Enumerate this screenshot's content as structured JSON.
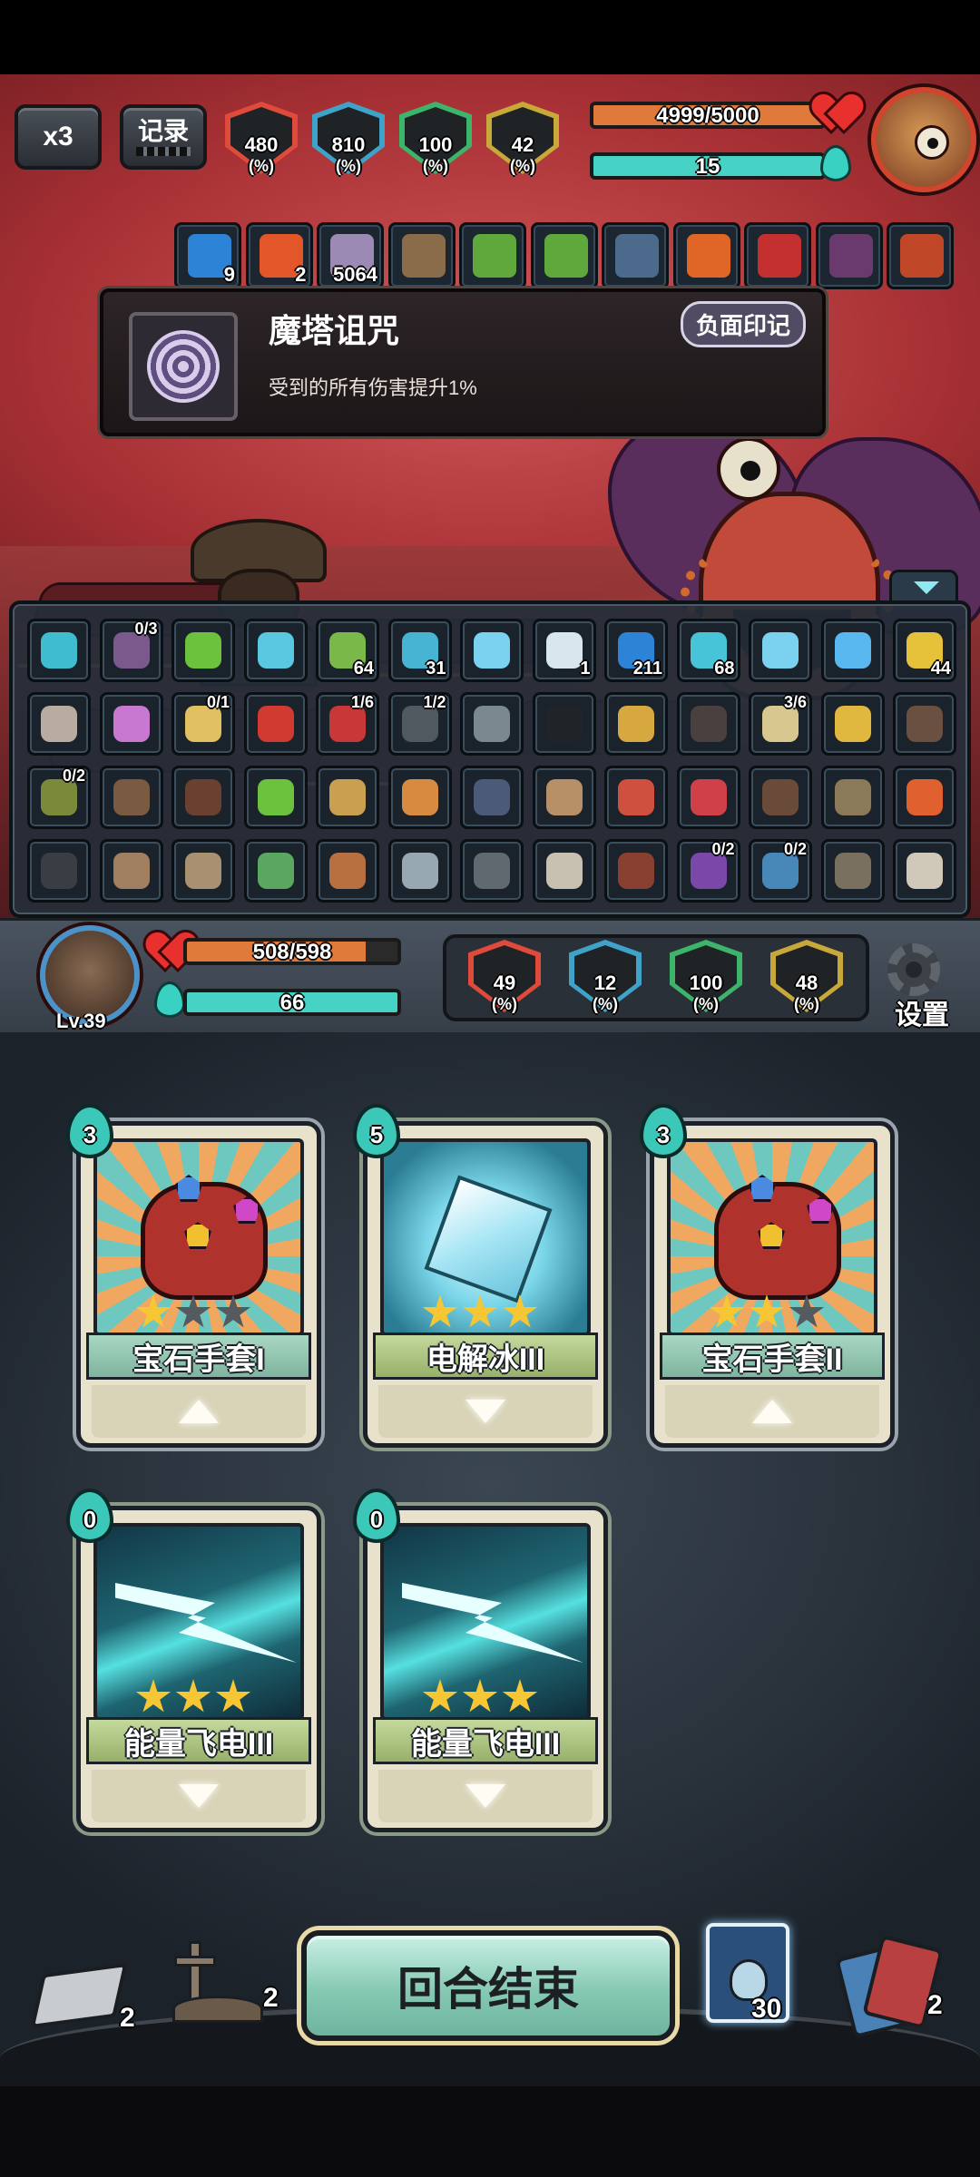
{
  "top_hud": {
    "speed_label": "x3",
    "record_label": "记录",
    "enemy_stats": [
      {
        "id": "attack",
        "value": "480",
        "unit": "(%)",
        "color": "#e04a3a",
        "icon": "attack-down-arrow"
      },
      {
        "id": "crit",
        "value": "810",
        "unit": "(%)",
        "color": "#3fa2c9",
        "icon": "question-mark"
      },
      {
        "id": "defense",
        "value": "100",
        "unit": "(%)",
        "color": "#3cb46a",
        "icon": "shield-pillar"
      },
      {
        "id": "dodge",
        "value": "42",
        "unit": "(%)",
        "color": "#c9a83a",
        "icon": "up-arrow"
      }
    ],
    "enemy_hp": {
      "text": "4999/5000",
      "current": 4999,
      "max": 5000,
      "color": "#e07a3a"
    },
    "enemy_energy": {
      "text": "15",
      "fraction": 1.0,
      "color": "#46d2c4"
    }
  },
  "buffs": [
    {
      "icon": "shield-icon",
      "count": "9",
      "color": "#2d84d6"
    },
    {
      "icon": "burn-icon",
      "count": "2",
      "color": "#e2562a"
    },
    {
      "icon": "curse-spiral-icon",
      "count": "5064",
      "color": "#9b8ab3"
    },
    {
      "icon": "book-icon",
      "count": "",
      "color": "#8a6b4a"
    },
    {
      "icon": "green-rock-icon",
      "count": "",
      "color": "#5fa83c"
    },
    {
      "icon": "green-rock-icon",
      "count": "",
      "color": "#5fa83c"
    },
    {
      "icon": "statue-icon",
      "count": "",
      "color": "#4c6a8c"
    },
    {
      "icon": "fire-orb-icon",
      "count": "",
      "color": "#e06628"
    },
    {
      "icon": "red-tentacle-icon",
      "count": "",
      "color": "#c43030"
    },
    {
      "icon": "dark-wing-icon",
      "count": "",
      "color": "#6a3a6e"
    },
    {
      "icon": "bead-necklace-icon",
      "count": "",
      "color": "#c04828"
    }
  ],
  "tooltip": {
    "title": "魔塔诅咒",
    "badge": "负面印记",
    "description": "受到的所有伤害提升1%"
  },
  "relics": [
    [
      {
        "icon": "crystal-orb-icon",
        "color": "#3fbcd0",
        "count": "",
        "corner": ""
      },
      {
        "icon": "tentacle-icon",
        "color": "#7a5a8c",
        "count": "",
        "corner": "0/3"
      },
      {
        "icon": "green-stone-icon",
        "color": "#6cc23c",
        "count": "",
        "corner": ""
      },
      {
        "icon": "ice-block-icon",
        "color": "#5ac8e0",
        "count": "",
        "corner": ""
      },
      {
        "icon": "green-swirl-icon",
        "color": "#7ab84a",
        "count": "64",
        "corner": ""
      },
      {
        "icon": "lightning-portal-icon",
        "color": "#46b4d2",
        "count": "31",
        "corner": ""
      },
      {
        "icon": "ice-crystal-icon",
        "color": "#7ad2f0",
        "count": "",
        "corner": ""
      },
      {
        "icon": "triangle-rune-icon",
        "color": "#d8e6ee",
        "count": "1",
        "corner": ""
      },
      {
        "icon": "shield-icon",
        "color": "#2d84d6",
        "count": "211",
        "corner": ""
      },
      {
        "icon": "frost-face-icon",
        "color": "#48c4d8",
        "count": "68",
        "corner": ""
      },
      {
        "icon": "ice-crystal-icon",
        "color": "#7ad2f0",
        "count": "",
        "corner": ""
      },
      {
        "icon": "lightning-icon",
        "color": "#5ab8f0",
        "count": "",
        "corner": ""
      },
      {
        "icon": "clover-icon",
        "color": "#e6c23a",
        "count": "44",
        "corner": ""
      }
    ],
    [
      {
        "icon": "spike-shell-icon",
        "color": "#b8aca0",
        "count": "",
        "corner": ""
      },
      {
        "icon": "rainbow-crystal-icon",
        "color": "#c878d0",
        "count": "",
        "corner": ""
      },
      {
        "icon": "bell-flower-icon",
        "color": "#e0c060",
        "count": "",
        "corner": "0/1"
      },
      {
        "icon": "red-stick-icon",
        "color": "#d03a30",
        "count": "",
        "corner": ""
      },
      {
        "icon": "red-book-icon",
        "color": "#c83838",
        "count": "",
        "corner": "1/6"
      },
      {
        "icon": "camera-icon",
        "color": "#505860",
        "count": "",
        "corner": "1/2"
      },
      {
        "icon": "robot-icon",
        "color": "#7a8890",
        "count": "",
        "corner": ""
      },
      {
        "icon": "sunglasses-icon",
        "color": "#202428",
        "count": "",
        "corner": ""
      },
      {
        "icon": "broom-icon",
        "color": "#d8a840",
        "count": "",
        "corner": ""
      },
      {
        "icon": "dark-cage-icon",
        "color": "#4a4040",
        "count": "",
        "corner": ""
      },
      {
        "icon": "scroll-icon",
        "color": "#d8c890",
        "count": "",
        "corner": "3/6"
      },
      {
        "icon": "golden-horn-icon",
        "color": "#e0b840",
        "count": "",
        "corner": ""
      },
      {
        "icon": "dagger-icon",
        "color": "#6a5040",
        "count": "",
        "corner": ""
      }
    ],
    [
      {
        "icon": "banner-icon",
        "color": "#7a8a3a",
        "count": "",
        "corner": "0/2"
      },
      {
        "icon": "owl-icon",
        "color": "#7a5a40",
        "count": "",
        "corner": ""
      },
      {
        "icon": "sack-icon",
        "color": "#6a4030",
        "count": "",
        "corner": ""
      },
      {
        "icon": "green-potion-icon",
        "color": "#6cc23c",
        "count": "",
        "corner": ""
      },
      {
        "icon": "hourglass-icon",
        "color": "#c8a050",
        "count": "",
        "corner": ""
      },
      {
        "icon": "wooden-hand-icon",
        "color": "#d88a40",
        "count": "",
        "corner": ""
      },
      {
        "icon": "boots-icon",
        "color": "#4a5a78",
        "count": "",
        "corner": ""
      },
      {
        "icon": "cone-hat-icon",
        "color": "#b89068",
        "count": "",
        "corner": ""
      },
      {
        "icon": "matryoshka-icon",
        "color": "#d05040",
        "count": "",
        "corner": ""
      },
      {
        "icon": "red-monster-icon",
        "color": "#d04048",
        "count": "",
        "corner": ""
      },
      {
        "icon": "teddy-bear-icon",
        "color": "#6a4a38",
        "count": "",
        "corner": ""
      },
      {
        "icon": "helmet-icon",
        "color": "#8a7a5a",
        "count": "",
        "corner": ""
      },
      {
        "icon": "teapot-fire-icon",
        "color": "#e06030",
        "count": "",
        "corner": ""
      }
    ],
    [
      {
        "icon": "bear-trap-icon",
        "color": "#3a3e44",
        "count": "",
        "corner": ""
      },
      {
        "icon": "shield-face-icon",
        "color": "#a08060",
        "count": "",
        "corner": ""
      },
      {
        "icon": "spiral-shell-icon",
        "color": "#a89070",
        "count": "",
        "corner": ""
      },
      {
        "icon": "fish-icon",
        "color": "#5aa860",
        "count": "",
        "corner": ""
      },
      {
        "icon": "cookie-icon",
        "color": "#b87040",
        "count": "",
        "corner": ""
      },
      {
        "icon": "hook-icon",
        "color": "#98a8b0",
        "count": "",
        "corner": ""
      },
      {
        "icon": "trident-icon",
        "color": "#606870",
        "count": "",
        "corner": ""
      },
      {
        "icon": "teacup-icon",
        "color": "#c8c0b0",
        "count": "",
        "corner": ""
      },
      {
        "icon": "box-face-icon",
        "color": "#8a4030",
        "count": "",
        "corner": ""
      },
      {
        "icon": "purple-banner-icon",
        "color": "#7a48a8",
        "count": "",
        "corner": "0/2"
      },
      {
        "icon": "blue-banner-icon",
        "color": "#4888b8",
        "count": "",
        "corner": "0/2"
      },
      {
        "icon": "gear-box-icon",
        "color": "#7a7060",
        "count": "",
        "corner": ""
      },
      {
        "icon": "teapot-icon",
        "color": "#d0c8b8",
        "count": "",
        "corner": ""
      }
    ]
  ],
  "player": {
    "level": "Lv.39",
    "hp": {
      "text": "508/598",
      "current": 508,
      "max": 598,
      "color": "#e07a3a"
    },
    "energy": {
      "text": "66",
      "fraction": 1.0,
      "color": "#46d2c4"
    },
    "stats": [
      {
        "id": "attack",
        "value": "49",
        "unit": "(%)",
        "color": "#e04a3a",
        "icon": "attack-down-arrow"
      },
      {
        "id": "crit",
        "value": "12",
        "unit": "(%)",
        "color": "#3fa2c9",
        "icon": "question-mark"
      },
      {
        "id": "defense",
        "value": "100",
        "unit": "(%)",
        "color": "#3cb46a",
        "icon": "shield-pillar"
      },
      {
        "id": "dodge",
        "value": "48",
        "unit": "(%)",
        "color": "#c9a83a",
        "icon": "up-arrow"
      }
    ],
    "settings_label": "设置"
  },
  "hand": [
    {
      "name": "宝石手套I",
      "cost": "3",
      "stars": 1,
      "art": "gauntlet",
      "banner": "blue",
      "action": "up"
    },
    {
      "name": "电解冰III",
      "cost": "5",
      "stars": 3,
      "art": "ice",
      "banner": "green",
      "action": "down"
    },
    {
      "name": "宝石手套II",
      "cost": "3",
      "stars": 2,
      "art": "gauntlet",
      "banner": "blue",
      "action": "up"
    },
    {
      "name": "能量飞电III",
      "cost": "0",
      "stars": 3,
      "art": "bolt",
      "banner": "green",
      "action": "down"
    },
    {
      "name": "能量飞电III",
      "cost": "0",
      "stars": 3,
      "art": "bolt",
      "banner": "green",
      "action": "down"
    }
  ],
  "bottom": {
    "end_turn_label": "回合结束",
    "draw_pile_count": "2",
    "graveyard_count": "2",
    "potion_count": "30",
    "discard_pile_count": "2"
  }
}
